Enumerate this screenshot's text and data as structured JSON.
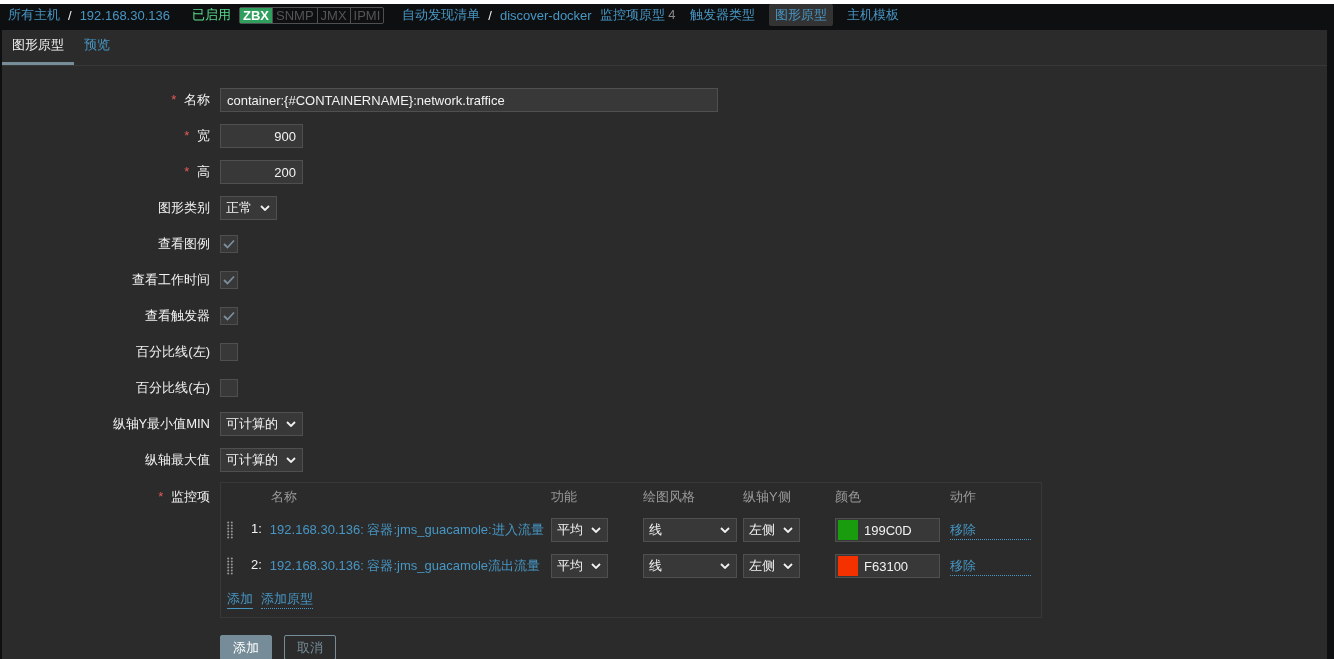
{
  "nav": [
    {
      "kind": "link",
      "text": "所有主机"
    },
    {
      "kind": "separator",
      "text": "/"
    },
    {
      "kind": "link",
      "text": "192.168.30.136"
    },
    {
      "kind": "status",
      "text": "已启用"
    },
    {
      "kind": "interfaces",
      "items": [
        {
          "label": "ZBX",
          "on": true
        },
        {
          "label": "SNMP",
          "on": false
        },
        {
          "label": "JMX",
          "on": false
        },
        {
          "label": "IPMI",
          "on": false
        }
      ]
    },
    {
      "kind": "link",
      "text": "自动发现清单"
    },
    {
      "kind": "separator",
      "text": "/"
    },
    {
      "kind": "link",
      "text": "discover-docker"
    },
    {
      "kind": "link",
      "text": "监控项原型",
      "count": "4"
    },
    {
      "kind": "tab",
      "text": "触发器类型",
      "selected": false
    },
    {
      "kind": "tab",
      "text": "图形原型",
      "selected": true
    },
    {
      "kind": "tab",
      "text": "主机模板",
      "selected": false
    }
  ],
  "tabs": [
    {
      "label": "图形原型",
      "selected": true
    },
    {
      "label": "预览",
      "selected": false
    }
  ],
  "fields": [
    {
      "kind": "text",
      "label": "名称",
      "required_mark": "*",
      "value": "container:{#CONTAINERNAME}:network.traffice"
    },
    {
      "kind": "number",
      "label": "宽",
      "required_mark": "*",
      "value": "900"
    },
    {
      "kind": "number",
      "label": "高",
      "required_mark": "*",
      "value": "200"
    },
    {
      "kind": "select",
      "label": "图形类别",
      "value": "正常"
    },
    {
      "kind": "checkbox",
      "label": "查看图例",
      "checked": true
    },
    {
      "kind": "checkbox",
      "label": "查看工作时间",
      "checked": true
    },
    {
      "kind": "checkbox",
      "label": "查看触发器",
      "checked": true
    },
    {
      "kind": "checkbox",
      "label": "百分比线(左)",
      "checked": false
    },
    {
      "kind": "checkbox",
      "label": "百分比线(右)",
      "checked": false
    },
    {
      "kind": "select",
      "label": "纵轴Y最小值MIN",
      "value": "可计算的"
    },
    {
      "kind": "select",
      "label": "纵轴最大值",
      "value": "可计算的"
    }
  ],
  "items": {
    "label": "监控项",
    "required_mark": "*",
    "columns": [
      "名称",
      "功能",
      "绘图风格",
      "纵轴Y侧",
      "颜色",
      "动作"
    ],
    "rows": [
      {
        "index": "1:",
        "name": "192.168.30.136: 容器:jms_guacamole:进入流量",
        "function": "平均",
        "draw_style": "线",
        "y_side": "左侧",
        "color": "#199c0d",
        "color_text": "199C0D",
        "action": "移除"
      },
      {
        "index": "2:",
        "name": "192.168.30.136: 容器:jms_guacamole流出流量",
        "function": "平均",
        "draw_style": "线",
        "y_side": "左侧",
        "color": "#f63100",
        "color_text": "F63100",
        "action": "移除"
      }
    ],
    "links": [
      "添加",
      "添加原型"
    ]
  },
  "buttons": [
    {
      "kind": "primary",
      "label": "添加"
    },
    {
      "kind": "secondary",
      "label": "取消"
    }
  ]
}
